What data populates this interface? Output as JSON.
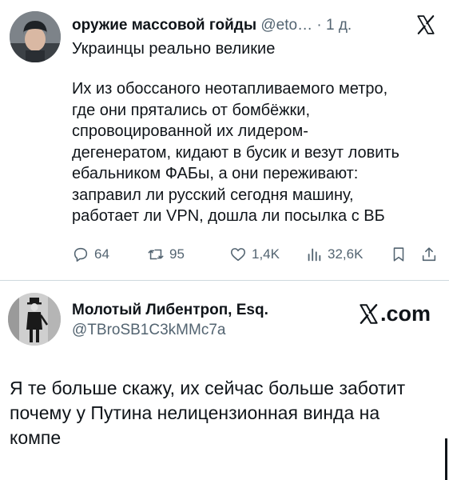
{
  "tweet": {
    "author_name": "оружие массовой гойды",
    "author_handle": "@eto…",
    "separator": "·",
    "time": "1 д.",
    "subtitle": "Украинцы реально великие",
    "body_lines": [
      "Их из обоссаного неотапливаемого метро,",
      "где они прятались от бомбёжки,",
      "спровоцированной их лидером-",
      "дегенератом, кидают в бусик и везут ловить",
      "ебальником ФАБы, а они переживают:",
      "заправил ли русский сегодня машину,",
      "работает ли VPN, дошла ли посылка с ВБ"
    ],
    "metrics": {
      "replies": "64",
      "retweets": "95",
      "likes": "1,4K",
      "views": "32,6K"
    },
    "icons": [
      "x-logo-icon",
      "reply-icon",
      "retweet-icon",
      "like-icon",
      "views-icon",
      "bookmark-icon",
      "share-icon"
    ]
  },
  "reply": {
    "author_name": "Молотый Либентроп, Esq.",
    "author_handle": "@TBroSB1C3kMMc7a",
    "brand_text": ".com",
    "body_lines": [
      "Я те больше скажу, их сейчас больше заботит",
      "почему у Путина нелицензионная винда на",
      "компе"
    ]
  },
  "colors": {
    "text": "#0f1419",
    "secondary": "#536471",
    "divider": "#cfd9de"
  }
}
